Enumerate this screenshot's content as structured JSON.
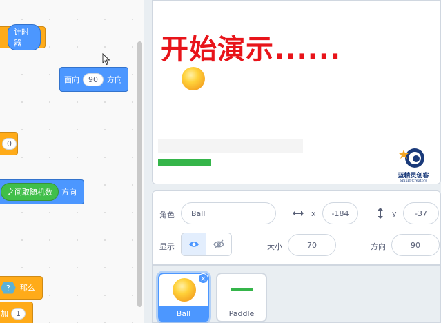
{
  "code": {
    "timer_reporter": "计时器",
    "point_direction": {
      "prefix": "面向",
      "value": "90",
      "suffix": "方向"
    },
    "zero_input": "0",
    "random_reporter": "之间取随机数",
    "direction_suffix": "方向",
    "if_hex": "?",
    "if_then": "那么",
    "add_label": "加",
    "add_value": "1"
  },
  "stage": {
    "overlay_text": "开始演示......",
    "logo_text": "蓝精灵创客",
    "logo_subtext": "Smurf Creators"
  },
  "sprite_info": {
    "sprite_label": "角色",
    "sprite_name": "Ball",
    "x_label": "x",
    "x_value": "-184",
    "y_label": "y",
    "y_value": "-37",
    "show_label": "显示",
    "size_label": "大小",
    "size_value": "70",
    "direction_label": "方向",
    "direction_value": "90"
  },
  "sprites": [
    {
      "name": "Ball",
      "selected": true
    },
    {
      "name": "Paddle",
      "selected": false
    }
  ],
  "colors": {
    "motion": "#4c97ff",
    "control": "#ffab19",
    "operator": "#40bf4a",
    "stage_text": "#e8141a",
    "paddle": "#35b54a"
  }
}
